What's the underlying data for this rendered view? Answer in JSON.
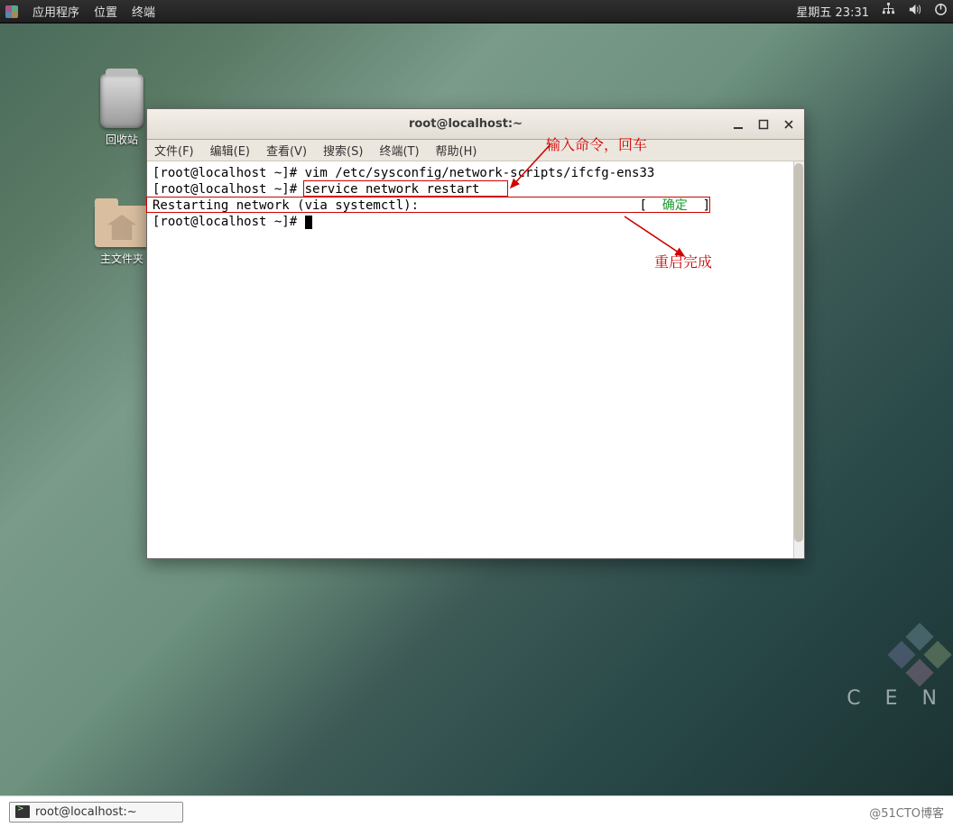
{
  "topbar": {
    "menu_apps": "应用程序",
    "menu_places": "位置",
    "menu_terminal": "终端",
    "clock": "星期五 23:31"
  },
  "desktop_icons": {
    "trash_label": "回收站",
    "home_label": "主文件夹"
  },
  "terminal": {
    "title": "root@localhost:~",
    "menus": {
      "file": "文件(F)",
      "edit": "编辑(E)",
      "view": "查看(V)",
      "search": "搜索(S)",
      "terminal": "终端(T)",
      "help": "帮助(H)"
    },
    "lines": {
      "prompt1": "[root@localhost ~]# vim /etc/sysconfig/network-scripts/ifcfg-ens33",
      "prompt2_left": "[root@localhost ~]# ",
      "prompt2_cmd": "service network restart",
      "restart_left": "Restarting network (via systemctl):",
      "restart_ok": "确定",
      "prompt3": "[root@localhost ~]# "
    }
  },
  "annotations": {
    "note1": "输入命令，回车",
    "note2": "重启完成"
  },
  "centos_text": "C E N",
  "taskbar": {
    "task_label": "root@localhost:~"
  },
  "watermark": "@51CTO博客"
}
